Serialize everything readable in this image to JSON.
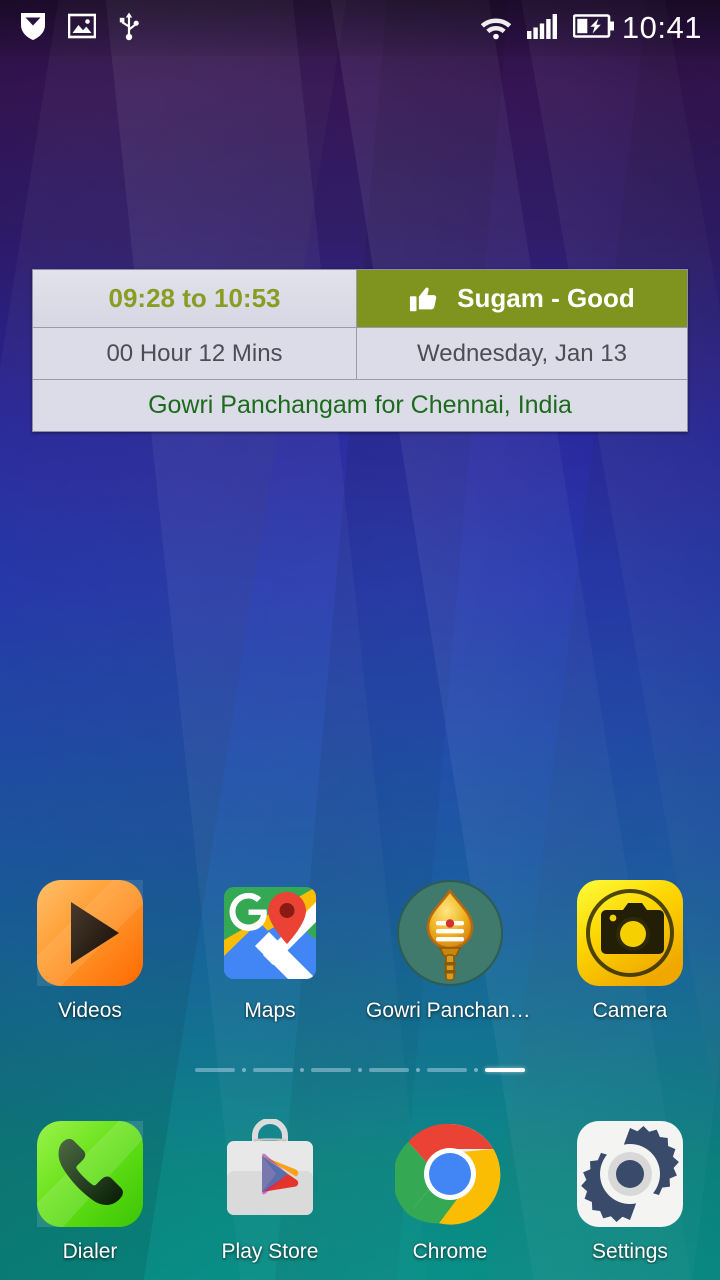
{
  "statusbar": {
    "time": "10:41",
    "left_icons": [
      {
        "name": "shield-badge-icon",
        "label": "security-badge"
      },
      {
        "name": "image-icon",
        "label": "screenshot"
      },
      {
        "name": "usb-icon",
        "label": "usb-connected"
      }
    ],
    "right_icons": [
      {
        "name": "wifi-icon",
        "label": "wifi"
      },
      {
        "name": "signal-icon",
        "label": "cellular-signal",
        "bars": 5
      },
      {
        "name": "battery-charging-icon",
        "label": "battery-charging"
      }
    ]
  },
  "widget": {
    "name": "gowri-panchangam-widget",
    "time_range": "09:28 to 10:53",
    "quality": "Sugam - Good",
    "quality_icon": "thumbs-up-icon",
    "duration": "00 Hour 12 Mins",
    "date": "Wednesday, Jan 13",
    "location": "Gowri Panchangam for Chennai,  India",
    "colors": {
      "quality_bg": "#7e941f",
      "time_text": "#8a9c24",
      "location_text": "#1c6b1c",
      "cell_bg": "#dcdce8"
    }
  },
  "home": {
    "row1": [
      {
        "label": "Videos",
        "icon": "videos-icon"
      },
      {
        "label": "Maps",
        "icon": "maps-icon"
      },
      {
        "label": "Gowri Panchang...",
        "icon": "gowri-panchangam-icon"
      },
      {
        "label": "Camera",
        "icon": "camera-icon"
      }
    ],
    "row2": [
      {
        "label": "Dialer",
        "icon": "dialer-icon"
      },
      {
        "label": "Play Store",
        "icon": "play-store-icon"
      },
      {
        "label": "Chrome",
        "icon": "chrome-icon"
      },
      {
        "label": "Settings",
        "icon": "settings-icon"
      }
    ],
    "pager": {
      "pages": 6,
      "active_index": 6
    }
  }
}
